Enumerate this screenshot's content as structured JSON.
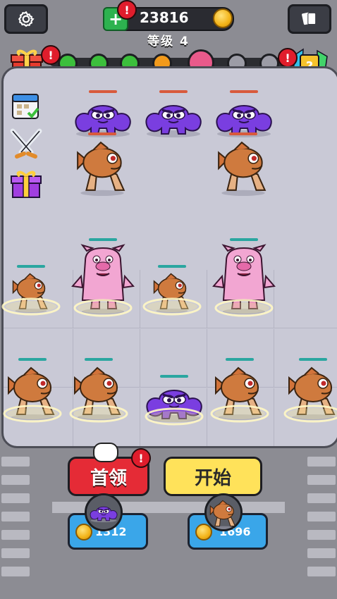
{
  "header": {
    "settings_icon": "gear-icon",
    "coins": "23816",
    "level_label": "等级 4",
    "cards_icon": "cards-icon",
    "alert_mark": "!"
  },
  "progress": {
    "stages": [
      "completed",
      "completed",
      "completed",
      "current",
      "boss",
      "locked",
      "locked"
    ],
    "colors": {
      "completed": "#3cbf3c",
      "current": "#f29a1c",
      "boss": "#e95a8b",
      "locked": "#9c9ca6"
    }
  },
  "side_menu": [
    "calendar-icon",
    "crossed-swords-icon",
    "gift-box-icon"
  ],
  "enemies": {
    "row1": [
      "purple-blob",
      "purple-blob",
      "purple-blob"
    ],
    "row2": [
      "walking-fish",
      "walking-fish"
    ]
  },
  "player_units": {
    "row1": [
      "walking-fish",
      "pink-pig-monster",
      "walking-fish",
      "pink-pig-monster"
    ],
    "row2": [
      "walking-fish",
      "walking-fish",
      "purple-blob",
      "walking-fish",
      "walking-fish"
    ]
  },
  "buttons": {
    "boss_label": "首领",
    "start_label": "开始"
  },
  "buy_cards": [
    {
      "unit": "purple-blob",
      "price": "1312"
    },
    {
      "unit": "walking-fish",
      "price": "1696"
    }
  ],
  "colors": {
    "boss_button": "#e52b36",
    "start_button": "#ffe25a",
    "buy_card": "#3aa6e9",
    "coin": "#f2b318"
  }
}
